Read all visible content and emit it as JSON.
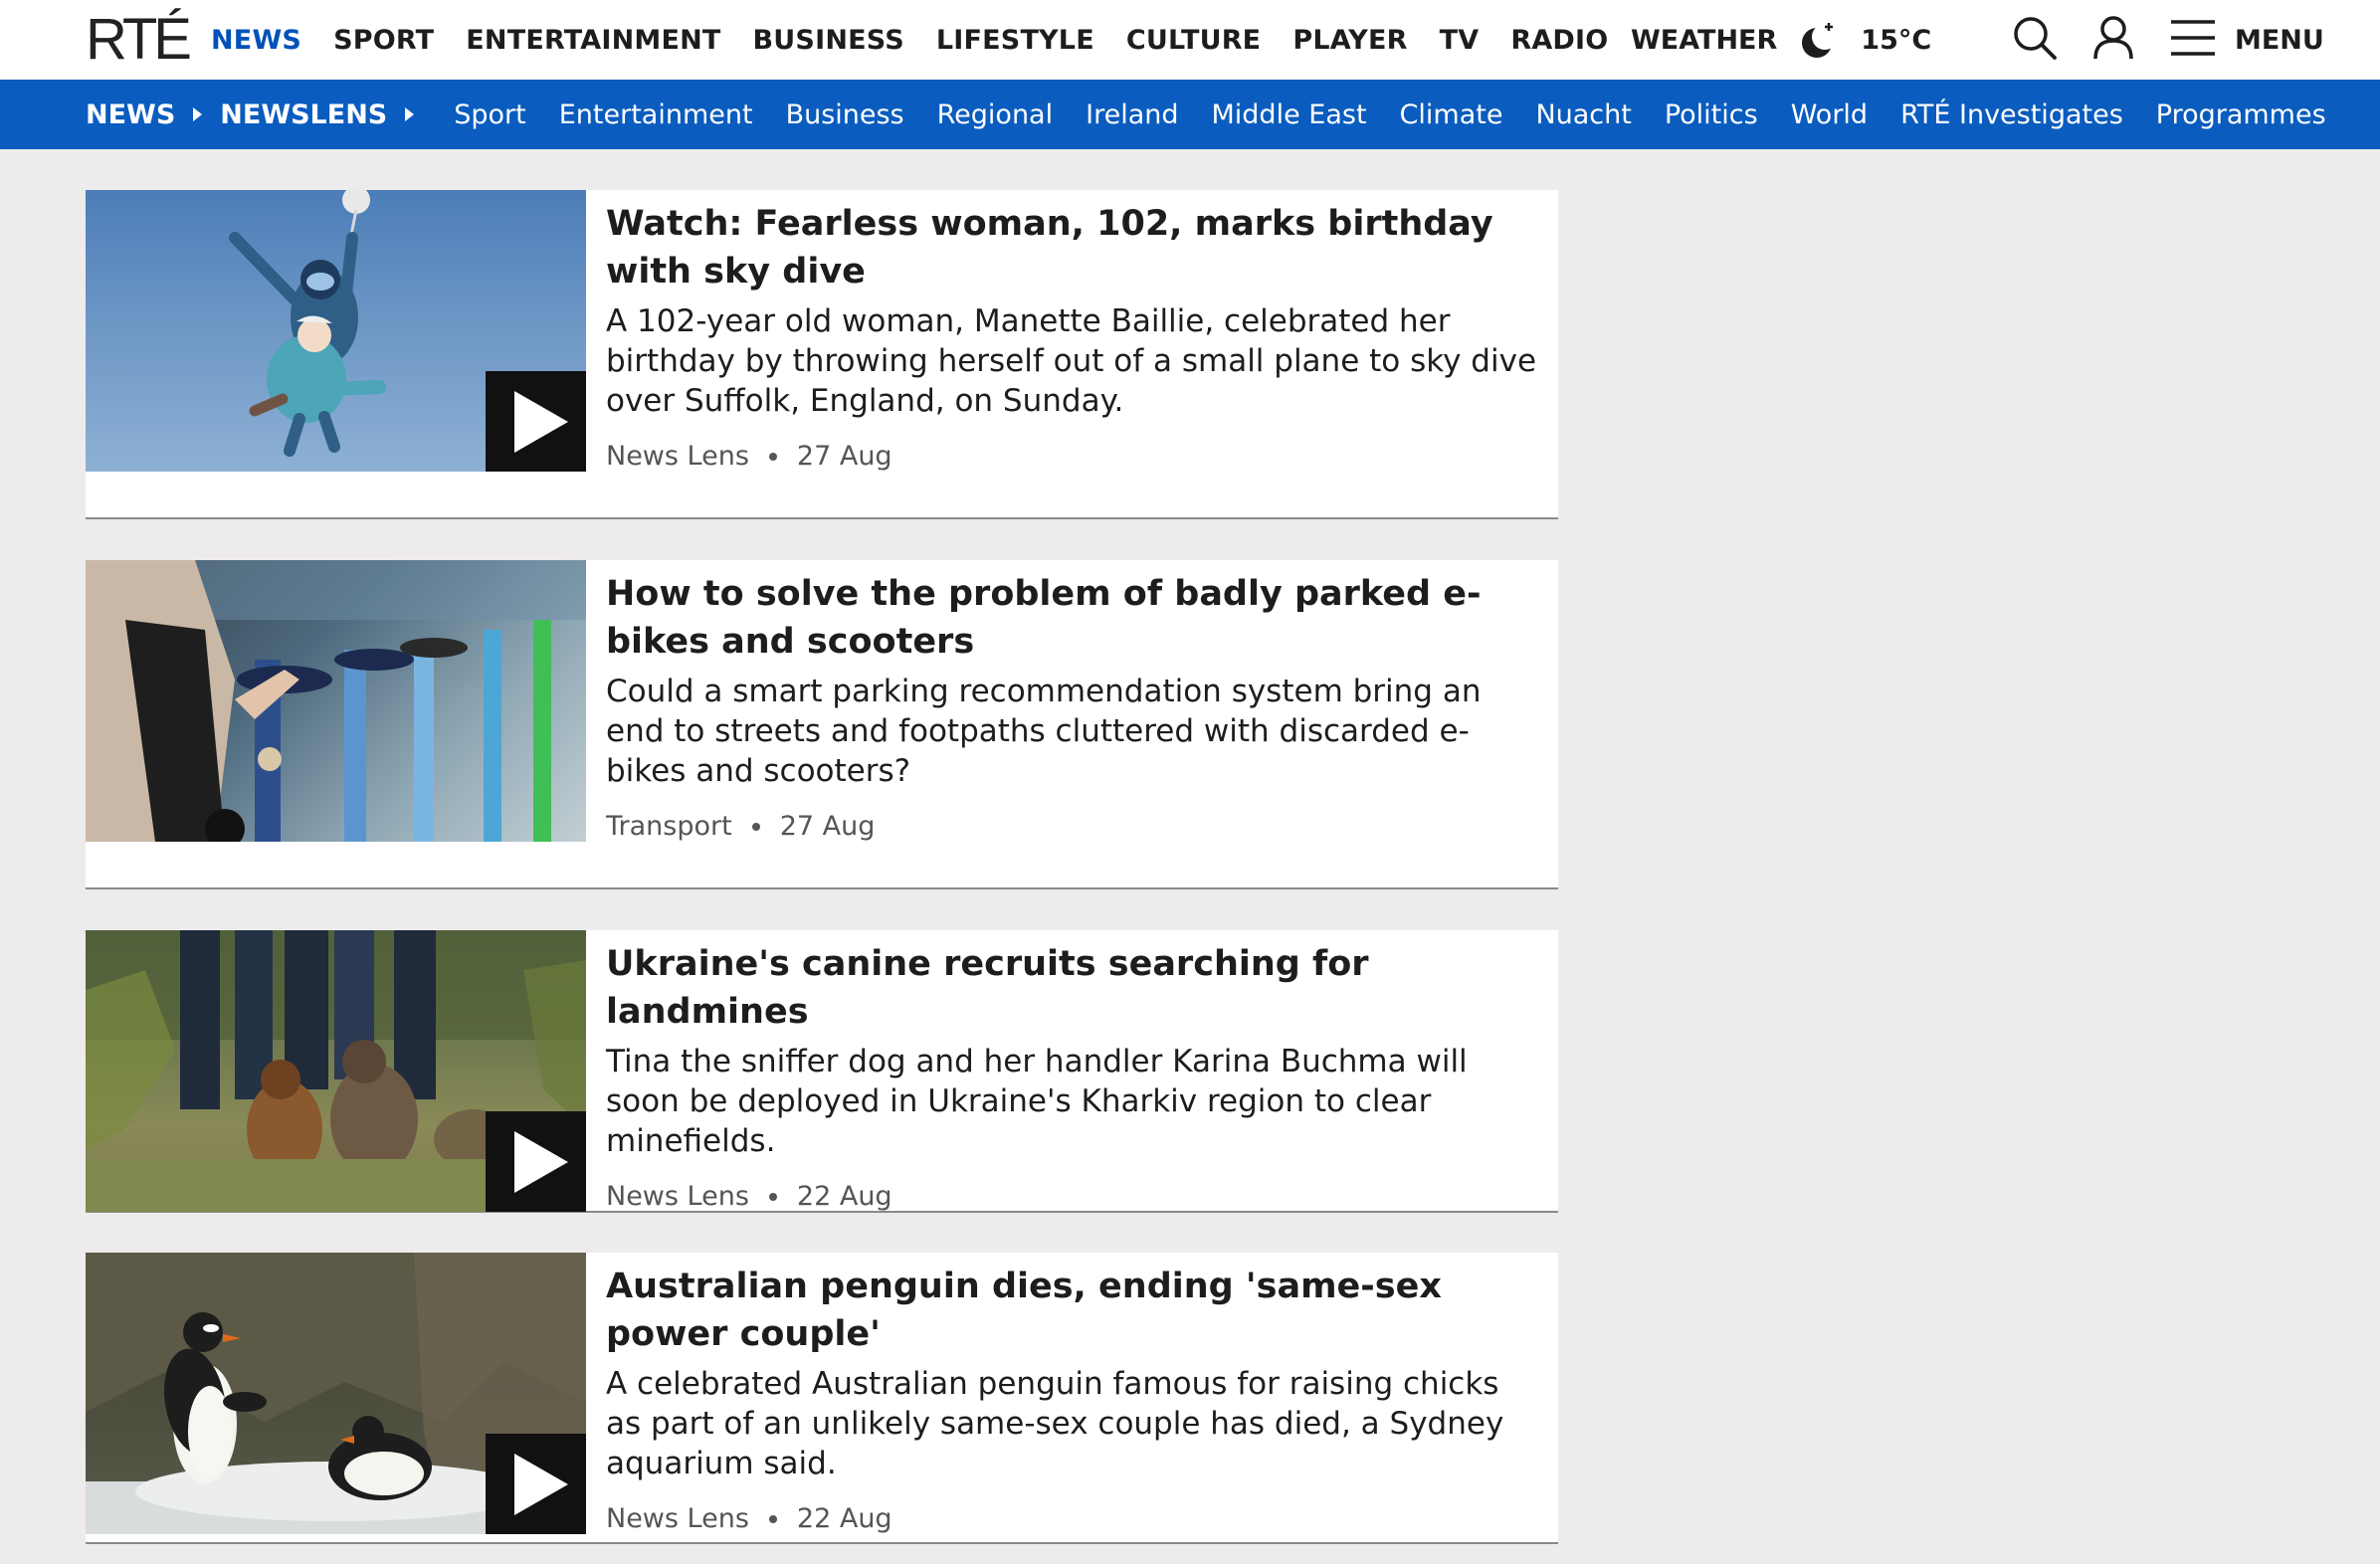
{
  "brand": {
    "logo": "RTÉ"
  },
  "main_nav": [
    "NEWS",
    "SPORT",
    "ENTERTAINMENT",
    "BUSINESS",
    "LIFESTYLE",
    "CULTURE",
    "PLAYER",
    "TV",
    "RADIO"
  ],
  "weather": {
    "label": "WEATHER",
    "temperature": "15°C",
    "icon": "moon-icon"
  },
  "header_actions": {
    "search_icon": "search-icon",
    "account_icon": "user-icon",
    "menu_icon": "hamburger-icon",
    "menu_label": "MENU"
  },
  "breadcrumb": [
    "NEWS",
    "NEWSLENS"
  ],
  "sub_nav": [
    "Sport",
    "Entertainment",
    "Business",
    "Regional",
    "Ireland",
    "Middle East",
    "Climate",
    "Nuacht",
    "Politics",
    "World",
    "RTÉ Investigates",
    "Programmes"
  ],
  "articles": [
    {
      "title": "Watch: Fearless woman, 102, marks birthday with sky dive",
      "description": "A 102-year old woman, Manette Baillie, celebrated her birthday by throwing herself out of a small plane to sky dive over Suffolk, England, on Sunday.",
      "category": "News Lens",
      "date": "27 Aug",
      "video": true
    },
    {
      "title": "How to solve the problem of badly parked e-bikes and scooters",
      "description": "Could a smart parking recommendation system bring an end to streets and footpaths cluttered with discarded e-bikes and scooters?",
      "category": "Transport",
      "date": "27 Aug",
      "video": false
    },
    {
      "title": "Ukraine's canine recruits searching for landmines",
      "description": "Tina the sniffer dog and her handler Karina Buchma will soon be deployed in Ukraine's Kharkiv region to clear minefields.",
      "category": "News Lens",
      "date": "22 Aug",
      "video": true
    },
    {
      "title": "Australian penguin dies, ending 'same-sex power couple'",
      "description": "A celebrated Australian penguin famous for raising chicks as part of an unlikely same-sex couple has died, a Sydney aquarium said.",
      "category": "News Lens",
      "date": "22 Aug",
      "video": true
    }
  ],
  "colors": {
    "brand_blue": "#0a5cbf",
    "active_nav": "#0051ba",
    "page_bg": "#edebeb"
  }
}
